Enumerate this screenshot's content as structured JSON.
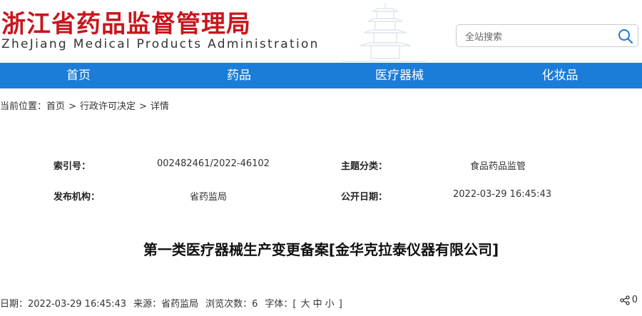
{
  "header": {
    "title_cn": "浙江省药品监督管理局",
    "title_en": "ZheJiang Medical Products Administration"
  },
  "search": {
    "placeholder": "全站搜索"
  },
  "nav": {
    "items": [
      "首页",
      "药品",
      "医疗器械",
      "化妆品"
    ]
  },
  "breadcrumb": {
    "prefix": "当前位置：",
    "items": [
      "首页",
      "行政许可决定",
      "详情"
    ],
    "separator": ">"
  },
  "meta": {
    "index_label": "索引号：",
    "index_value": "002482461/2022-46102",
    "category_label": "主题分类：",
    "category_value": "食品药品监管",
    "publisher_label": "发布机构：",
    "publisher_value": "省药监局",
    "date_label": "公开日期：",
    "date_value": "2022-03-29 16:45:43"
  },
  "document": {
    "title": "第一类医疗器械生产变更备案[金华克拉泰仪器有限公司]"
  },
  "info": {
    "date": "日期：2022-03-29 16:45:43",
    "source": "来源：省药监局",
    "views": "浏览次数：6",
    "font_label": "字体：[",
    "font_large": "大",
    "font_medium": "中",
    "font_small": "小",
    "font_close": "]"
  },
  "share": {
    "count": "0"
  },
  "colors": {
    "brand_red": "#c8161d",
    "nav_blue": "#1a7dd8"
  }
}
